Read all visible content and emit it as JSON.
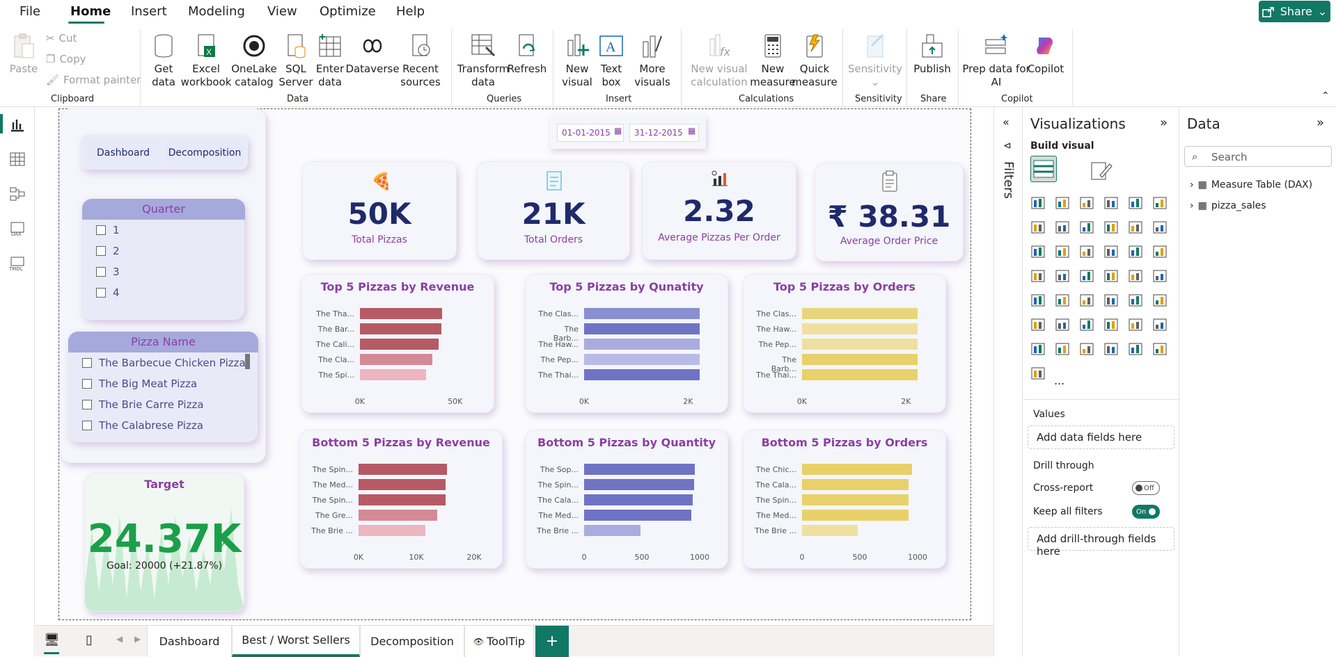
{
  "menu": {
    "items": [
      "File",
      "Home",
      "Insert",
      "Modeling",
      "View",
      "Optimize",
      "Help"
    ],
    "share_label": "Share"
  },
  "ribbon": {
    "clipboard": {
      "paste": "Paste",
      "cut": "Cut",
      "copy": "Copy",
      "format_painter": "Format painter",
      "group": "Clipboard"
    },
    "data": {
      "get_data": "Get\ndata",
      "excel": "Excel\nworkbook",
      "onelake": "OneLake\ncatalog",
      "sql": "SQL\nServer",
      "enter": "Enter\ndata",
      "dataverse": "Dataverse",
      "recent": "Recent\nsources",
      "group": "Data"
    },
    "queries": {
      "transform": "Transform\ndata",
      "refresh": "Refresh",
      "group": "Queries"
    },
    "insert": {
      "new_visual": "New\nvisual",
      "text_box": "Text\nbox",
      "more_visuals": "More\nvisuals",
      "group": "Insert"
    },
    "calculations": {
      "new_visual_calc": "New visual\ncalculation",
      "new_measure": "New\nmeasure",
      "quick_measure": "Quick\nmeasure",
      "group": "Calculations"
    },
    "sensitivity": {
      "label": "Sensitivity",
      "group": "Sensitivity"
    },
    "share": {
      "publish": "Publish",
      "group": "Share"
    },
    "copilot": {
      "prep": "Prep data for\nAI",
      "copilot": "Copilot",
      "group": "Copilot"
    }
  },
  "report": {
    "nav_buttons": [
      "Dashboard",
      "Decomposition"
    ],
    "date_from": "01-01-2015",
    "date_to": "31-12-2015",
    "quarter_slicer": {
      "title": "Quarter",
      "items": [
        "1",
        "2",
        "3",
        "4"
      ]
    },
    "pizza_slicer": {
      "title": "Pizza Name",
      "items": [
        "The Barbecue Chicken Pizza",
        "The Big Meat Pizza",
        "The Brie Carre Pizza",
        "The Calabrese Pizza"
      ]
    },
    "target": {
      "title": "Target",
      "value": "24.37K",
      "goal": "Goal: 20000 (+21.87%)"
    },
    "kpis": [
      {
        "value": "50K",
        "label": "Total Pizzas",
        "icon": "pizza-icon"
      },
      {
        "value": "21K",
        "label": "Total Orders",
        "icon": "orders-icon"
      },
      {
        "value": "2.32",
        "label": "Average Pizzas Per Order",
        "icon": "chart-icon"
      },
      {
        "value": "₹ 38.31",
        "label": "Average Order Price",
        "icon": "clipboard-icon"
      }
    ]
  },
  "chart_data": [
    {
      "type": "bar",
      "title": "Top 5 Pizzas by Revenue",
      "categories": [
        "The Tha...",
        "The Bar...",
        "The Cali...",
        "The Cla...",
        "The Spi..."
      ],
      "values": [
        43000,
        42700,
        41400,
        38000,
        34800
      ],
      "ticks": [
        "0K",
        "50K"
      ],
      "xlim": [
        0,
        50000
      ],
      "colors": [
        "#b65a66",
        "#b65a66",
        "#b65a66",
        "#d48a95",
        "#ecb6bf"
      ]
    },
    {
      "type": "bar",
      "title": "Top 5 Pizzas by Qunatity",
      "categories": [
        "The Clas...",
        "The Barb...",
        "The Haw...",
        "The Pep...",
        "The Thai..."
      ],
      "values": [
        2450,
        2430,
        2420,
        2420,
        2370
      ],
      "ticks": [
        "0K",
        "2K"
      ],
      "xlim": [
        0,
        2000
      ],
      "colors": [
        "#8a8fd0",
        "#6f73c4",
        "#a9acdf",
        "#b8bbe6",
        "#6f73c4"
      ]
    },
    {
      "type": "bar",
      "title": "Top 5 Pizzas by Orders",
      "categories": [
        "The Clas...",
        "The Haw...",
        "The Pep...",
        "The Barb...",
        "The Thai..."
      ],
      "values": [
        2330,
        2280,
        2280,
        2270,
        2220
      ],
      "ticks": [
        "0K",
        "2K"
      ],
      "xlim": [
        0,
        2000
      ],
      "colors": [
        "#e8d67c",
        "#efe0a0",
        "#efe0a0",
        "#e8d16a",
        "#e8d16a"
      ]
    },
    {
      "type": "bar",
      "title": "Bottom 5 Pizzas by Revenue",
      "categories": [
        "The Spin...",
        "The Med...",
        "The Spin...",
        "The Gre...",
        "The Brie ..."
      ],
      "values": [
        15300,
        15000,
        15000,
        13600,
        11600
      ],
      "ticks": [
        "0K",
        "10K",
        "20K"
      ],
      "xlim": [
        0,
        20000
      ],
      "colors": [
        "#b65a66",
        "#b65a66",
        "#b65a66",
        "#d48a95",
        "#ecb6bf"
      ]
    },
    {
      "type": "bar",
      "title": "Bottom 5 Pizzas by Quantity",
      "categories": [
        "The Sop...",
        "The Spin...",
        "The Cala...",
        "The Med...",
        "The Brie ..."
      ],
      "values": [
        960,
        950,
        940,
        930,
        490
      ],
      "ticks": [
        "0",
        "500",
        "1000"
      ],
      "xlim": [
        0,
        1000
      ],
      "colors": [
        "#6f73c4",
        "#6f73c4",
        "#6f73c4",
        "#6f73c4",
        "#a9acdf"
      ]
    },
    {
      "type": "bar",
      "title": "Bottom 5 Pizzas by Orders",
      "categories": [
        "The Chic...",
        "The Cala...",
        "The Spin...",
        "The Med...",
        "The Brie ..."
      ],
      "values": [
        950,
        920,
        920,
        920,
        480
      ],
      "ticks": [
        "0",
        "500",
        "1000"
      ],
      "xlim": [
        0,
        1000
      ],
      "colors": [
        "#e8d16a",
        "#e8d16a",
        "#e8d16a",
        "#e8d16a",
        "#efe0a0"
      ]
    }
  ],
  "filters_label": "Filters",
  "viz_pane": {
    "title": "Visualizations",
    "build_visual": "Build visual",
    "values_label": "Values",
    "values_placeholder": "Add data fields here",
    "drill_through": "Drill through",
    "cross_report": "Cross-report",
    "cross_state": "Off",
    "keep_filters": "Keep all filters",
    "keep_state": "On",
    "drill_placeholder": "Add drill-through fields here",
    "more": "..."
  },
  "data_pane": {
    "title": "Data",
    "search_placeholder": "Search",
    "tables": [
      "Measure Table (DAX)",
      "pizza_sales"
    ]
  },
  "tabs": [
    "Dashboard",
    "Best / Worst Sellers",
    "Decomposition",
    "ToolTip"
  ],
  "colors": {
    "accent": "#117865",
    "kpi": "#1f2a6b",
    "title": "#8b3fa3",
    "target_green": "#1aa049"
  }
}
